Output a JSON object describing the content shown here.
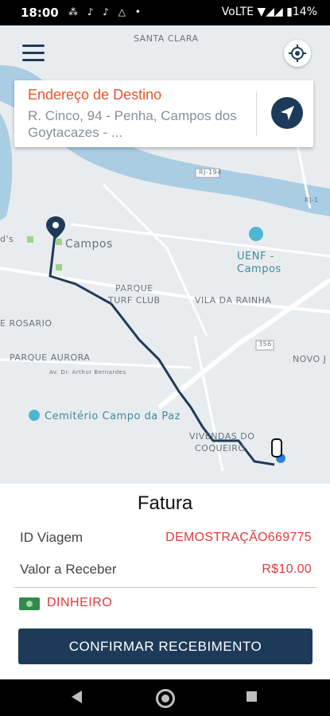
{
  "status_bar": {
    "time": "18:00",
    "left_icons": "⁂ ♪ ♪ △ •",
    "right_text": "VoLTE ▼◢◢ ▮14%"
  },
  "map": {
    "labels": {
      "santa_clara": "SANTA CLARA",
      "rj194": "RJ-194",
      "rj": "RJ-1",
      "campos": "Campos",
      "uenf": "UENF -",
      "uenf2": "Campos",
      "parque_turf": "PARQUE",
      "parque_turf2": "TURF CLUB",
      "vila_rainha": "VILA DA RAINHA",
      "rosario": "E ROSARIO",
      "parque_aurora": "PARQUE AURORA",
      "av_arthur": "Av. Dr. Arthur Bernardes",
      "road356": "356",
      "novo_j": "NOVO J",
      "cemiterio": "Cemitério Campo da Paz",
      "vivendas": "VIVENDAS DO",
      "coqueiro": "COQUEIRO",
      "lds": "d's"
    }
  },
  "destination": {
    "title": "Endereço de Destino",
    "address": "R. Cinco, 94 - Penha, Campos dos Goytacazes - ..."
  },
  "invoice": {
    "title": "Fatura",
    "trip_id_label": "ID Viagem",
    "trip_id_value": "DEMOSTRAÇÃO669775",
    "amount_label": "Valor a Receber",
    "amount_value": "R$10.00",
    "payment_method": "DINHEIRO",
    "confirm_label": "CONFIRMAR RECEBIMENTO"
  },
  "colors": {
    "accent_orange": "#e8542a",
    "primary_navy": "#1d3b59",
    "value_red": "#e23b3b",
    "money_green": "#2e8b4a"
  },
  "icons": {
    "menu": "hamburger-icon",
    "locate": "crosshair-icon",
    "navigate": "navigation-arrow-icon",
    "cash": "cash-icon",
    "back": "back-triangle-icon",
    "home": "home-circle-icon",
    "recent": "recent-square-icon"
  }
}
